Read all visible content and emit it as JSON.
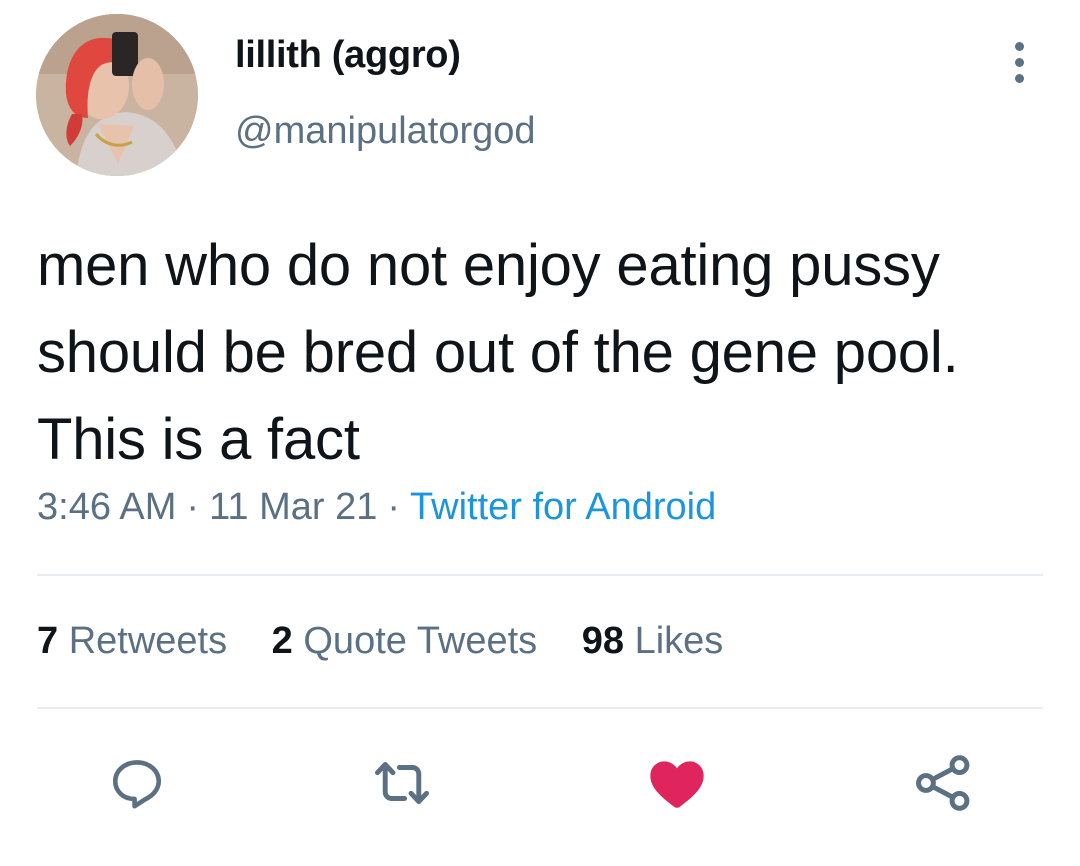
{
  "user": {
    "display_name": "lillith (aggro)",
    "handle": "@manipulatorgod"
  },
  "tweet": {
    "text": "men who do not enjoy eating pussy should be bred out of the gene pool. This is a fact",
    "time": "3:46 AM",
    "date": "11 Mar 21",
    "source": "Twitter for Android"
  },
  "stats": {
    "retweets_count": "7",
    "retweets_label": "Retweets",
    "quotes_count": "2",
    "quotes_label": "Quote Tweets",
    "likes_count": "98",
    "likes_label": "Likes"
  },
  "actions": [
    "reply-icon",
    "retweet-icon",
    "like-icon",
    "share-icon"
  ],
  "colors": {
    "text": "#0f1419",
    "secondary": "#5b7083",
    "link": "#1b95e0",
    "like": "#e0245e",
    "divider": "#e6ecf0"
  }
}
